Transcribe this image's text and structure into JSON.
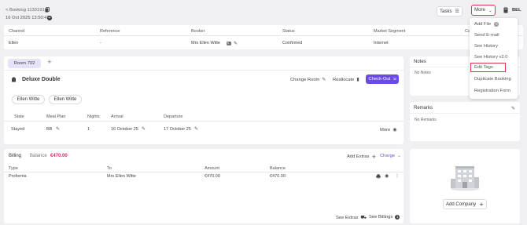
{
  "header": {
    "booking_label": "< Booking 1133191",
    "datetime": "16 Oct 2025 13:50:43",
    "tasks_label": "Tasks",
    "more_label": "More",
    "user_badge": "BEL"
  },
  "summary": {
    "columns": [
      "Channel",
      "Reference",
      "Booker",
      "Status",
      "Market Segment",
      "Ca"
    ],
    "values": [
      "Ellen",
      "-",
      "Mrs Ellen Witte",
      "Confirmed",
      "Internet"
    ]
  },
  "more_menu": {
    "items": [
      "Add File",
      "Send E-mail",
      "See History",
      "See History v2.0",
      "Edit Tags",
      "Duplicate Booking",
      "Registration Form"
    ],
    "add_file_count": "0"
  },
  "room": {
    "tab_label": "Room 702",
    "add_tab": "+",
    "room_type": "Deluxe Double",
    "change_room": "Change Room",
    "reallocate": "Reallocate",
    "check_out": "Check-Out",
    "guests": [
      "Ellen Witte",
      "Ellen Witte"
    ],
    "columns": [
      "State",
      "Meal Plan",
      "Nights",
      "Arrival",
      "Departure"
    ],
    "row": {
      "state": "Stayed",
      "meal_plan": "BB",
      "nights": "1",
      "arrival": "16 October 25",
      "departure": "17 October 25",
      "more": "More"
    }
  },
  "billing": {
    "title": "Billing",
    "balance_label": "Balance",
    "balance_value": "€470.00",
    "add_extras": "Add Extras",
    "charge": "Charge",
    "columns": [
      "Type",
      "To",
      "Amount",
      "Balance"
    ],
    "row": {
      "type": "Proforma",
      "to": "Mrs Ellen Witte",
      "amount": "€470.00",
      "balance": "€470.00"
    },
    "see_extras": "See Extras",
    "see_billings": "See Billings",
    "billings_count": "1"
  },
  "notes": {
    "title": "Notes",
    "empty": "No Notes"
  },
  "remarks": {
    "title": "Remarks",
    "empty": "No Remarks"
  },
  "company": {
    "add_company": "Add Company"
  },
  "colors": {
    "accent": "#6c4ce0",
    "balance": "#e0245e",
    "menu_highlight": "#d9364a",
    "room_tab": "#e6e2f8"
  }
}
